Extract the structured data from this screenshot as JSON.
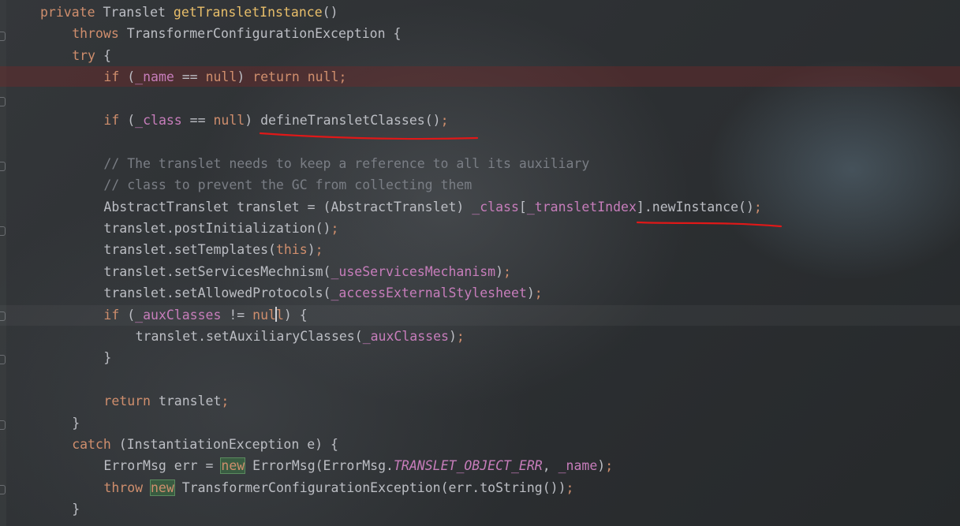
{
  "editor": {
    "lines": [
      {
        "indent": 0,
        "tokens": [
          [
            "kw",
            "private "
          ],
          [
            "",
            "Translet "
          ],
          [
            "fn",
            "getTransletInstance"
          ],
          [
            "",
            "()"
          ]
        ]
      },
      {
        "indent": 1,
        "tokens": [
          [
            "kw",
            "throws "
          ],
          [
            "",
            "TransformerConfigurationException {"
          ]
        ]
      },
      {
        "indent": 1,
        "tokens": [
          [
            "kw",
            "try "
          ],
          [
            "",
            "{"
          ]
        ]
      },
      {
        "indent": 2,
        "tokens": [
          [
            "kw",
            "if "
          ],
          [
            "",
            "("
          ],
          [
            "fld",
            "_name"
          ],
          [
            "",
            " == "
          ],
          [
            "kw",
            "null"
          ],
          [
            "",
            ") "
          ],
          [
            "kw",
            "return null"
          ],
          [
            "kw",
            ";"
          ]
        ]
      },
      {
        "indent": 0,
        "tokens": []
      },
      {
        "indent": 2,
        "tokens": [
          [
            "kw",
            "if "
          ],
          [
            "",
            "("
          ],
          [
            "fld",
            "_class"
          ],
          [
            "",
            " == "
          ],
          [
            "kw",
            "null"
          ],
          [
            "",
            ") defineTransletClasses()"
          ],
          [
            "kw",
            ";"
          ]
        ]
      },
      {
        "indent": 0,
        "tokens": []
      },
      {
        "indent": 2,
        "tokens": [
          [
            "cm",
            "// The translet needs to keep a reference to all its auxiliary"
          ]
        ]
      },
      {
        "indent": 2,
        "tokens": [
          [
            "cm",
            "// class to prevent the GC from collecting them"
          ]
        ]
      },
      {
        "indent": 2,
        "tokens": [
          [
            "",
            "AbstractTranslet translet = (AbstractTranslet) "
          ],
          [
            "fld",
            "_class"
          ],
          [
            "",
            "["
          ],
          [
            "fld",
            "_transletIndex"
          ],
          [
            "",
            "].newInstance()"
          ],
          [
            "kw",
            ";"
          ]
        ]
      },
      {
        "indent": 2,
        "tokens": [
          [
            "",
            "translet.postInitialization()"
          ],
          [
            "kw",
            ";"
          ]
        ]
      },
      {
        "indent": 2,
        "tokens": [
          [
            "",
            "translet.setTemplates("
          ],
          [
            "kw",
            "this"
          ],
          [
            "",
            ")"
          ],
          [
            "kw",
            ";"
          ]
        ]
      },
      {
        "indent": 2,
        "tokens": [
          [
            "",
            "translet.setServicesMechnism("
          ],
          [
            "fld",
            "_useServicesMechanism"
          ],
          [
            "",
            ")"
          ],
          [
            "kw",
            ";"
          ]
        ]
      },
      {
        "indent": 2,
        "tokens": [
          [
            "",
            "translet.setAllowedProtocols("
          ],
          [
            "fld",
            "_accessExternalStylesheet"
          ],
          [
            "",
            ")"
          ],
          [
            "kw",
            ";"
          ]
        ]
      },
      {
        "indent": 2,
        "tokens": [
          [
            "kw",
            "if "
          ],
          [
            "",
            "("
          ],
          [
            "fld",
            "_auxClasses"
          ],
          [
            "",
            " != "
          ],
          [
            "kw",
            "nul"
          ],
          [
            "caret",
            ""
          ],
          [
            "kw",
            "l"
          ],
          [
            "",
            ") {"
          ]
        ]
      },
      {
        "indent": 3,
        "tokens": [
          [
            "",
            "translet.setAuxiliaryClasses("
          ],
          [
            "fld",
            "_auxClasses"
          ],
          [
            "",
            ")"
          ],
          [
            "kw",
            ";"
          ]
        ]
      },
      {
        "indent": 2,
        "tokens": [
          [
            "",
            "}"
          ]
        ]
      },
      {
        "indent": 0,
        "tokens": []
      },
      {
        "indent": 2,
        "tokens": [
          [
            "kw",
            "return "
          ],
          [
            "",
            "translet"
          ],
          [
            "kw",
            ";"
          ]
        ]
      },
      {
        "indent": 1,
        "tokens": [
          [
            "",
            "}"
          ]
        ]
      },
      {
        "indent": 1,
        "tokens": [
          [
            "kw",
            "catch "
          ],
          [
            "",
            "(InstantiationException e) {"
          ]
        ]
      },
      {
        "indent": 2,
        "tokens": [
          [
            "",
            "ErrorMsg err = "
          ],
          [
            "kwbox",
            "new"
          ],
          [
            "",
            " ErrorMsg(ErrorMsg."
          ],
          [
            "const",
            "TRANSLET_OBJECT_ERR"
          ],
          [
            "",
            ", "
          ],
          [
            "fld",
            "_name"
          ],
          [
            "",
            ")"
          ],
          [
            "kw",
            ";"
          ]
        ]
      },
      {
        "indent": 2,
        "tokens": [
          [
            "kw",
            "throw "
          ],
          [
            "kwbox",
            "new"
          ],
          [
            "",
            " TransformerConfigurationException(err.toString())"
          ],
          [
            "kw",
            ";"
          ]
        ]
      },
      {
        "indent": 1,
        "tokens": [
          [
            "",
            "}"
          ]
        ]
      }
    ]
  },
  "annotations": {
    "underline_1_color": "#e01818",
    "underline_2_color": "#e01818"
  },
  "colors": {
    "keyword": "#cf8e6d",
    "method_decl": "#e8be6a",
    "field": "#c77dbb",
    "comment": "#7a7e85",
    "text": "#bcbec4",
    "error_line": "#782828"
  }
}
